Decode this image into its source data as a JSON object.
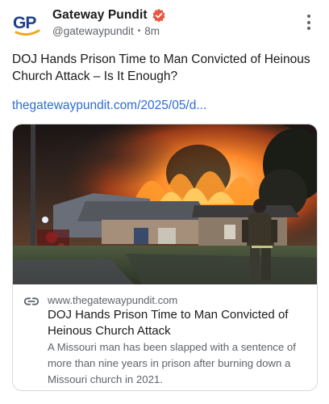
{
  "author": {
    "display_name": "Gateway Pundit",
    "handle": "@gatewaypundit",
    "separator": "•",
    "time_ago": "8m",
    "avatar_initials": "GP",
    "verified": true
  },
  "post": {
    "text": "DOJ Hands Prison Time to Man Convicted of Heinous Church Attack – Is It Enough?",
    "link_text": "thegatewaypundit.com/2025/05/d..."
  },
  "link_card": {
    "image_description": "Church building engulfed in fire at night with a firefighter walking toward it",
    "domain": "www.thegatewaypundit.com",
    "title": "DOJ Hands Prison Time to Man Convicted of Heinous Church Attack",
    "description": "A Missouri man has been slapped with a sentence of more than nine years in prison after burning down a Missouri church in 2021."
  },
  "colors": {
    "link": "#2c6cd6",
    "verified_badge": "#e7573f",
    "avatar_blue": "#1f3e8a",
    "avatar_gold": "#f0a81c",
    "muted_text": "#5f6368"
  },
  "icons": {
    "more": "more-vertical-icon",
    "link": "link-icon",
    "verified": "verified-badge-icon"
  }
}
